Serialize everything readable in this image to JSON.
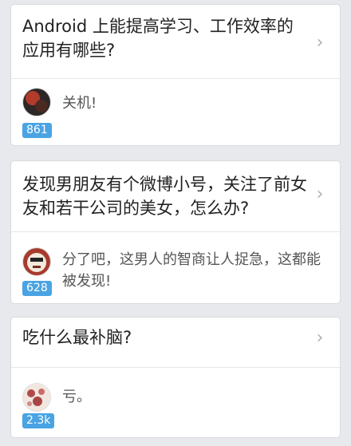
{
  "cards": [
    {
      "question": "Android 上能提高学习、工作效率的应用有哪些?",
      "answer": "关机!",
      "votes": "861"
    },
    {
      "question": "发现男朋友有个微博小号，关注了前女友和若干公司的美女，怎么办?",
      "answer": "分了吧，这男人的智商让人捉急，这都能被发现!",
      "votes": "628"
    },
    {
      "question": "吃什么最补脑?",
      "answer": "亏。",
      "votes": "2.3k"
    }
  ],
  "icons": {
    "chevron": "chevron-right-icon",
    "avatar": "avatar"
  },
  "colors": {
    "vote_badge": "#4aa3e3",
    "chevron": "#aab0b8"
  }
}
